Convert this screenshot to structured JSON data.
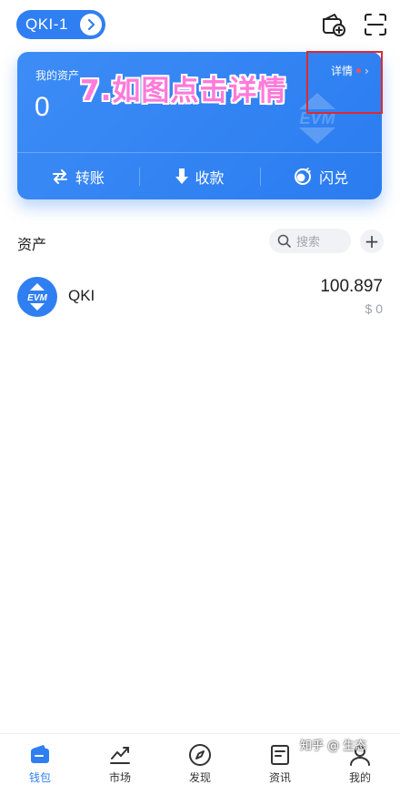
{
  "header": {
    "wallet_name": "QKI-1"
  },
  "card": {
    "label": "我的资产",
    "value": "0",
    "watermark": "EVM",
    "detail_label": "详情",
    "actions": [
      {
        "label": "转账",
        "icon": "transfer-icon"
      },
      {
        "label": "收款",
        "icon": "receive-icon"
      },
      {
        "label": "闪兑",
        "icon": "swap-icon"
      }
    ]
  },
  "annotation": {
    "text": "7.如图点击详情",
    "box_color": "#e0282e"
  },
  "assets": {
    "title": "资产",
    "search_placeholder": "搜索",
    "add_label": "+"
  },
  "tokens": [
    {
      "logo_text": "EVM",
      "name": "QKI",
      "amount": "100.897",
      "fiat": "$ 0"
    }
  ],
  "nav": {
    "items": [
      {
        "label": "钱包",
        "icon": "wallet-icon",
        "active": true
      },
      {
        "label": "市场",
        "icon": "market-icon",
        "active": false
      },
      {
        "label": "发现",
        "icon": "compass-icon",
        "active": false
      },
      {
        "label": "资讯",
        "icon": "news-icon",
        "active": false
      },
      {
        "label": "我的",
        "icon": "profile-icon",
        "active": false
      }
    ]
  },
  "watermark": "知乎 @ 生态",
  "colors": {
    "accent": "#2f7ff2",
    "annotation_text": "#ff7ad9",
    "detail_dot": "#ff4d4f"
  }
}
